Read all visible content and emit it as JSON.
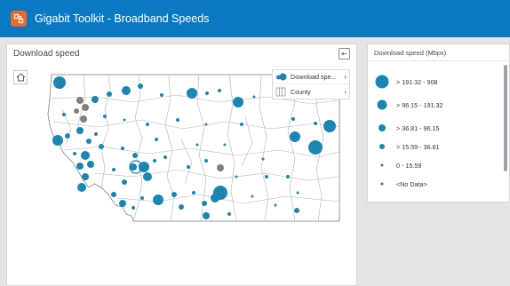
{
  "app": {
    "title": "Gigabit Toolkit - Broadband Speeds",
    "logo_icon": "gigabit-toolkit-logo-icon",
    "colors": {
      "header": "#0b79c2",
      "logo": "#ea6a2c",
      "symbol": "#1a86b4",
      "nodata": "#808080"
    }
  },
  "map_card": {
    "title": "Download speed",
    "layers": [
      {
        "label": "Download spe...",
        "icon": "graduated-symbol-icon"
      },
      {
        "label": "County",
        "icon": "polygon-layer-icon"
      }
    ]
  },
  "legend": {
    "title": "Download speed (Mbps)",
    "items": [
      {
        "label": "> 191.32 - 908"
      },
      {
        "label": "> 96.15 - 191.32"
      },
      {
        "label": "> 36.81 - 96.15"
      },
      {
        "label": "> 15.59 - 36.81"
      },
      {
        "label": "0 - 15.59"
      },
      {
        "label": "<No Data>"
      }
    ]
  }
}
